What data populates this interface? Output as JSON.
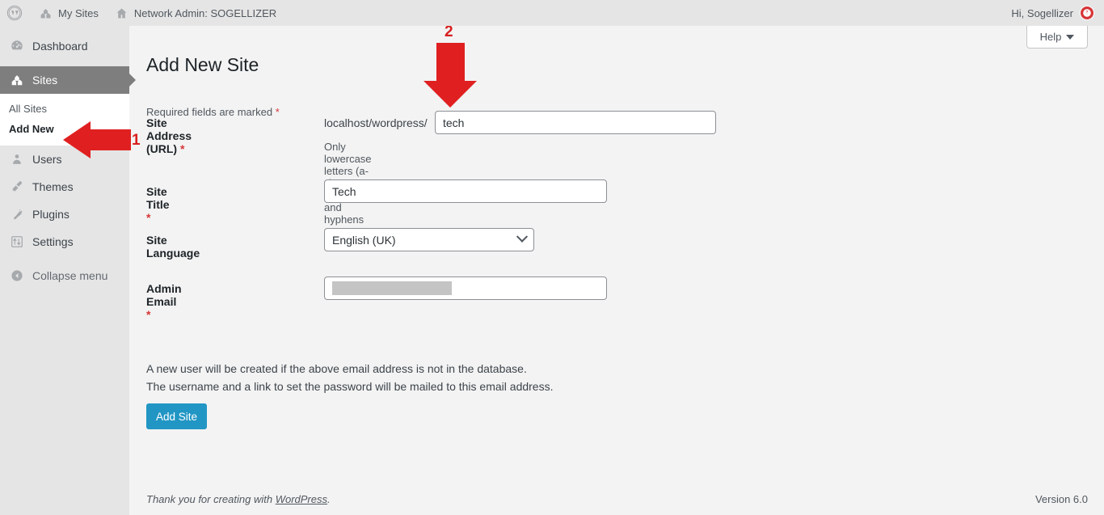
{
  "adminbar": {
    "wp_logo_label": "wordpress-logo",
    "my_sites": "My Sites",
    "network_admin": "Network Admin: SOGELLIZER",
    "greeting": "Hi, Sogellizer",
    "avatar_label": "avatar"
  },
  "sidebar": {
    "items": [
      {
        "label": "Dashboard",
        "icon": "dashboard-icon",
        "current": false
      },
      {
        "label": "Sites",
        "icon": "sites-icon",
        "current": true
      },
      {
        "label": "Users",
        "icon": "users-icon",
        "current": false
      },
      {
        "label": "Themes",
        "icon": "themes-icon",
        "current": false
      },
      {
        "label": "Plugins",
        "icon": "plugins-icon",
        "current": false
      },
      {
        "label": "Settings",
        "icon": "settings-icon",
        "current": false
      }
    ],
    "submenu": [
      {
        "label": "All Sites",
        "current": false
      },
      {
        "label": "Add New",
        "current": true
      }
    ],
    "collapse": "Collapse menu"
  },
  "content": {
    "help_button": "Help",
    "page_title": "Add New Site",
    "required_note": "Required fields are marked",
    "required_mark": "*",
    "fields": {
      "site_address": {
        "label": "Site Address (URL)",
        "required": "*",
        "prefix": "localhost/wordpress/",
        "value": "tech",
        "placeholder": "",
        "hint": "Only lowercase letters (a-z), numbers, and hyphens are allowed."
      },
      "site_title": {
        "label": "Site Title",
        "required": "*",
        "value": "Tech",
        "placeholder": ""
      },
      "site_language": {
        "label": "Site Language",
        "required": "",
        "value": "English (UK)"
      },
      "admin_email": {
        "label": "Admin Email",
        "required": "*",
        "value": "",
        "redacted": true
      }
    },
    "note_line1": "A new user will be created if the above email address is not in the database.",
    "note_line2": "The username and a link to set the password will be mailed to this email address.",
    "submit_button": "Add Site"
  },
  "footer": {
    "thanks_prefix": "Thank you for creating with ",
    "thanks_link": "WordPress",
    "thanks_suffix": ".",
    "version": "Version 6.0"
  },
  "annotations": [
    {
      "number": "1",
      "direction": "left",
      "target": "Add New"
    },
    {
      "number": "2",
      "direction": "down",
      "target": "Site Address input"
    }
  ],
  "colors": {
    "adminbar_bg": "#e5e5e5",
    "sidebar_bg": "#e5e5e5",
    "sidebar_active_bg": "#7e7e7e",
    "content_bg": "#f3f3f3",
    "primary_button": "#2196c4",
    "required_star": "#d63638",
    "annotation_red": "#e02020"
  }
}
